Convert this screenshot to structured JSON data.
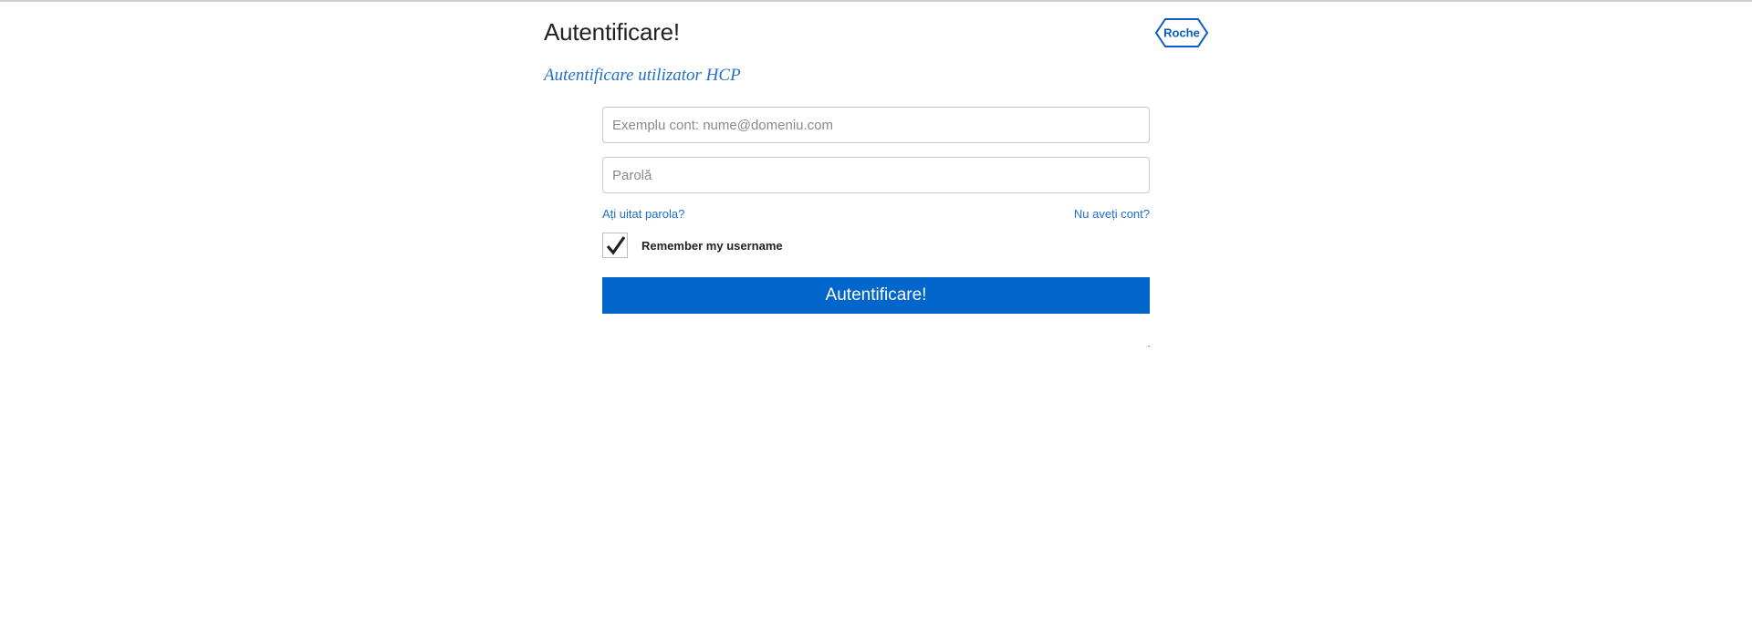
{
  "header": {
    "title": "Autentificare!",
    "logo_text": "Roche"
  },
  "subtitle": "Autentificare utilizator HCP",
  "form": {
    "email": {
      "value": "",
      "placeholder": "Exemplu cont: nume@domeniu.com"
    },
    "password": {
      "value": "",
      "placeholder": "Parolă"
    },
    "forgot_password_link": "Ați uitat parola?",
    "register_link": "Nu aveți cont?",
    "remember_me": {
      "label": "Remember my username",
      "checked": true
    },
    "submit_label": "Autentificare!"
  },
  "colors": {
    "accent": "#0066cc",
    "link": "#1f6fcf",
    "logo": "#0b5cc7"
  },
  "icons": {
    "logo": "roche-hexagon-logo",
    "checkbox": "checkmark-icon"
  }
}
